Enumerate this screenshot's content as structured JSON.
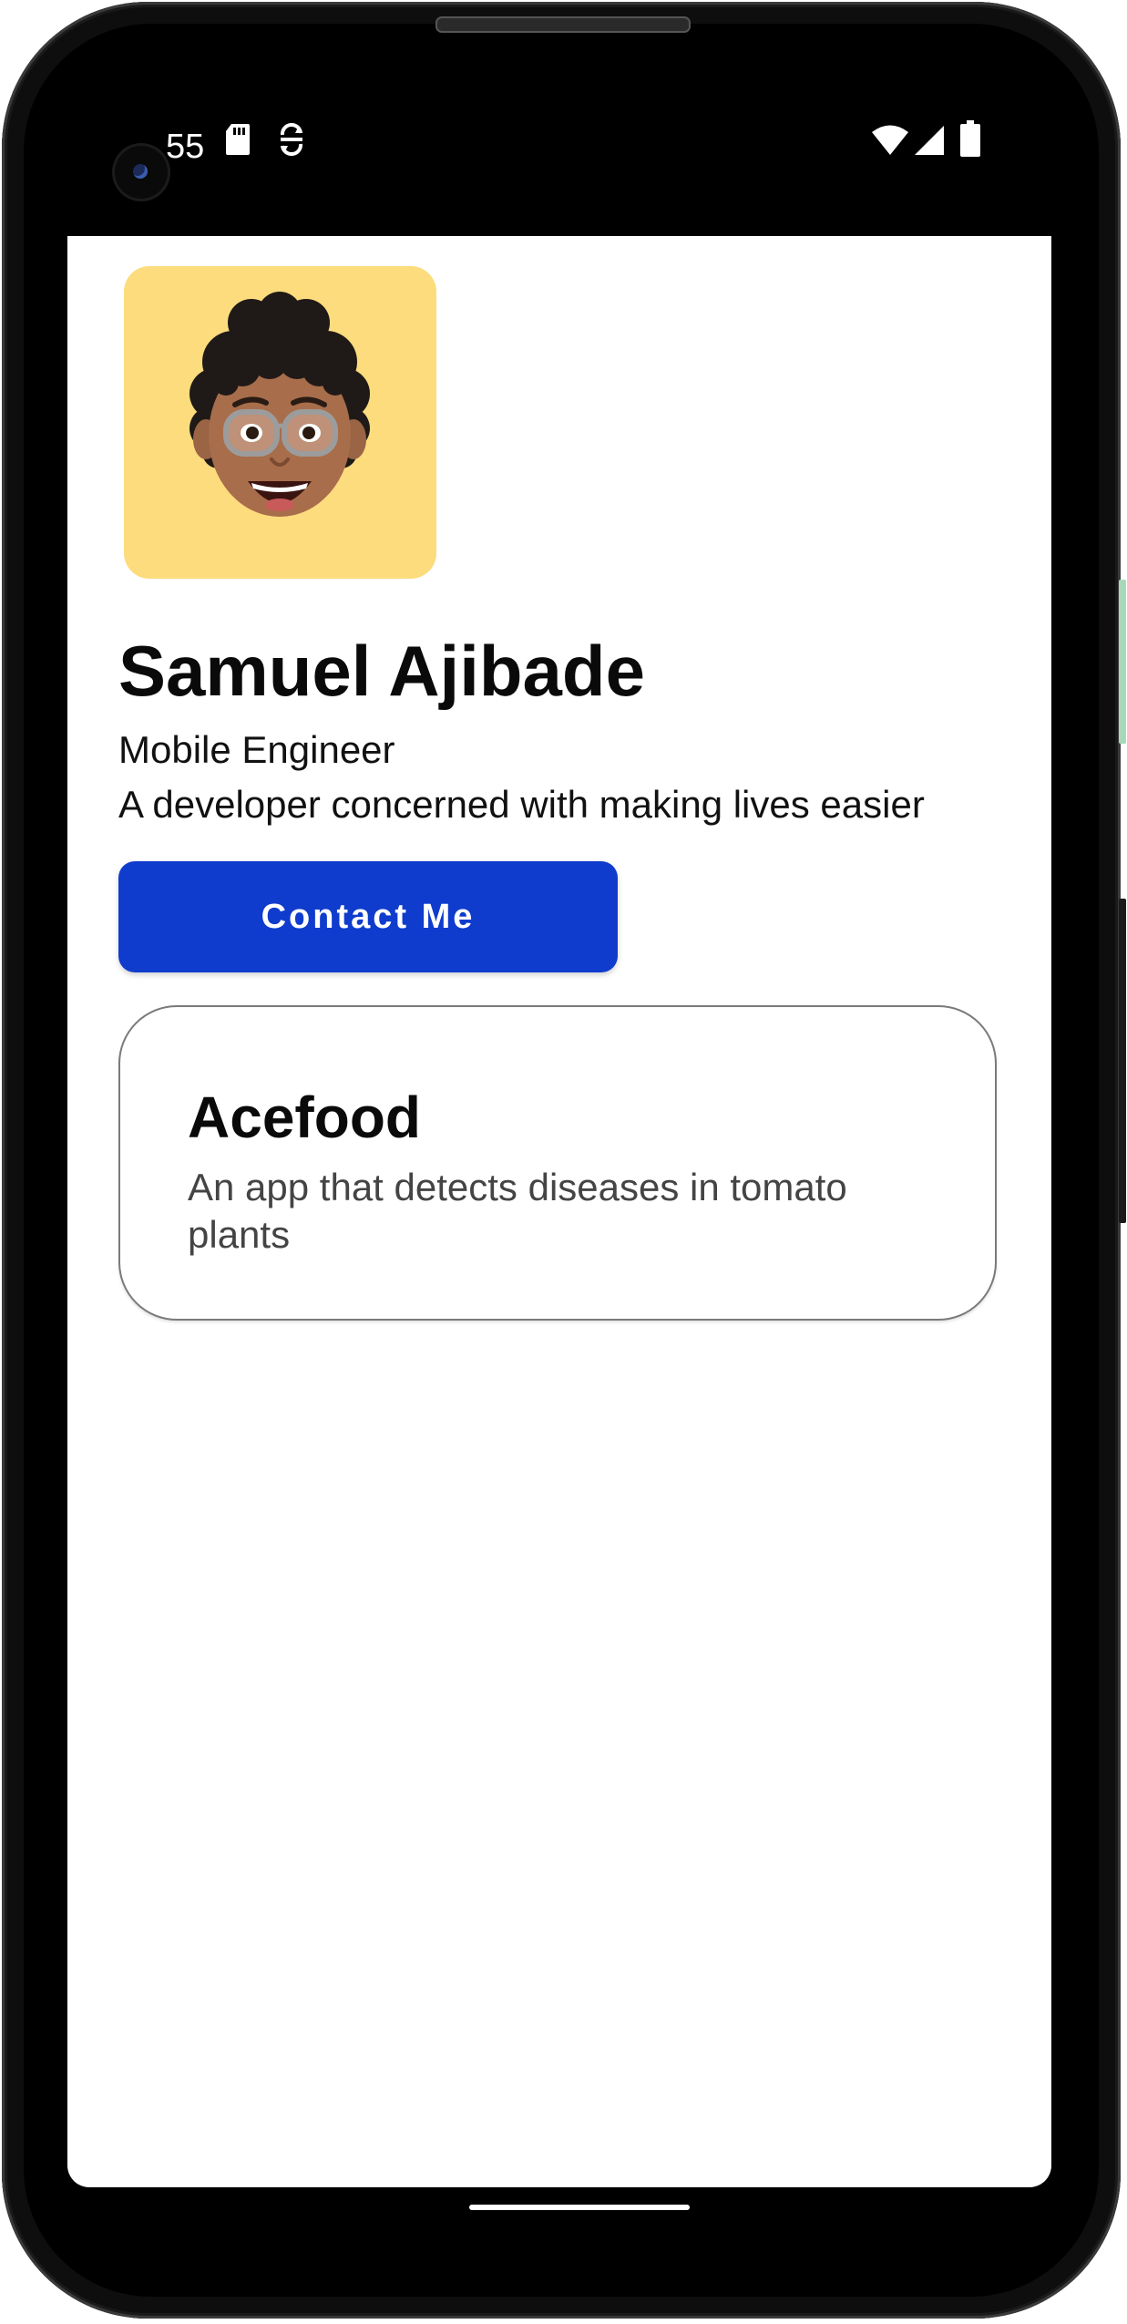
{
  "status_bar": {
    "time": "55",
    "icons": [
      "sd-card-icon",
      "sync-icon",
      "wifi-icon",
      "signal-icon",
      "battery-icon"
    ]
  },
  "profile": {
    "avatar_icon": "memoji-avatar-icon",
    "avatar_bg": "#fcdc7d",
    "name": "Samuel Ajibade",
    "role": "Mobile Engineer",
    "bio": "A developer concerned with making lives easier"
  },
  "contact_button": {
    "label": "Contact Me",
    "color": "#0f3ccd"
  },
  "project_card": {
    "title": "Acefood",
    "description": "An app that detects diseases in tomato plants"
  }
}
